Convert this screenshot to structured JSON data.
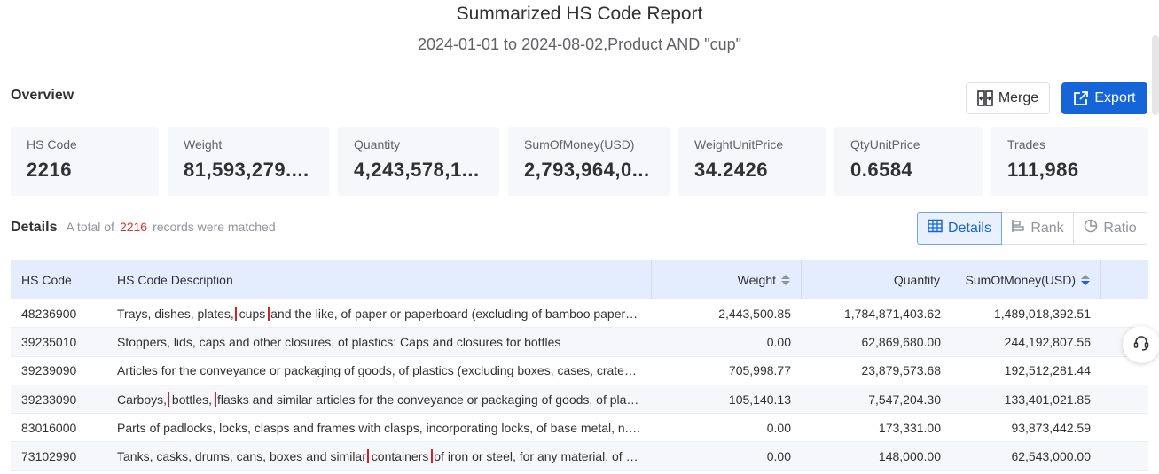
{
  "report": {
    "title": "Summarized HS Code Report",
    "subtitle": "2024-01-01 to 2024-08-02,Product AND \"cup\""
  },
  "overview": {
    "label": "Overview",
    "merge_label": "Merge",
    "export_label": "Export",
    "stats": [
      {
        "label": "HS Code",
        "value": "2216"
      },
      {
        "label": "Weight",
        "value": "81,593,279...."
      },
      {
        "label": "Quantity",
        "value": "4,243,578,1..."
      },
      {
        "label": "SumOfMoney(USD)",
        "value": "2,793,964,0..."
      },
      {
        "label": "WeightUnitPrice",
        "value": "34.2426"
      },
      {
        "label": "QtyUnitPrice",
        "value": "0.6584"
      },
      {
        "label": "Trades",
        "value": "111,986"
      }
    ]
  },
  "details": {
    "label": "Details",
    "note_prefix": "A total of",
    "count": "2216",
    "note_suffix": "records were matched",
    "views": {
      "details": "Details",
      "rank": "Rank",
      "ratio": "Ratio"
    }
  },
  "table": {
    "headers": {
      "hs_code": "HS Code",
      "description": "HS Code Description",
      "weight": "Weight",
      "quantity": "Quantity",
      "sum": "SumOfMoney(USD)"
    },
    "rows": [
      {
        "hs_code": "48236900",
        "desc_before": "Trays, dishes, plates,",
        "highlight": "cups",
        "desc_after": "and the like, of paper or paperboard (excluding of bamboo paper or ba...",
        "weight": "2,443,500.85",
        "quantity": "1,784,871,403.62",
        "sum": "1,489,018,392.51"
      },
      {
        "hs_code": "39235010",
        "desc_before": "Stoppers, lids, caps and other closures, of plastics: Caps and closures for bottles",
        "highlight": "",
        "desc_after": "",
        "weight": "0.00",
        "quantity": "62,869,680.00",
        "sum": "244,192,807.56"
      },
      {
        "hs_code": "39239090",
        "desc_before": "Articles for the conveyance or packaging of goods, of plastics (excluding boxes, cases, crates an...",
        "highlight": "",
        "desc_after": "",
        "weight": "705,998.77",
        "quantity": "23,879,573.68",
        "sum": "192,512,281.44"
      },
      {
        "hs_code": "39233090",
        "desc_before": "Carboys,",
        "highlight": "bottles,",
        "desc_after": "flasks and similar articles for the conveyance or packaging of goods, of plastics...",
        "weight": "105,140.13",
        "quantity": "7,547,204.30",
        "sum": "133,401,021.85"
      },
      {
        "hs_code": "83016000",
        "desc_before": "Parts of padlocks, locks, clasps and frames with clasps, incorporating locks, of base metal, n.e.s.",
        "highlight": "",
        "desc_after": "",
        "weight": "0.00",
        "quantity": "173,331.00",
        "sum": "93,873,442.59"
      },
      {
        "hs_code": "73102990",
        "desc_before": "Tanks, casks, drums, cans, boxes and similar",
        "highlight": "containers",
        "desc_after": "of iron or steel, for any material, of a cap...",
        "weight": "0.00",
        "quantity": "148,000.00",
        "sum": "62,543,000.00"
      }
    ]
  },
  "colors": {
    "accent": "#1565d8",
    "header_bg": "#e4edfd",
    "highlight_box": "#d9201c",
    "count": "#e0302c"
  },
  "icons": {
    "merge": "merge-icon",
    "export": "export-icon",
    "details": "table-icon",
    "rank": "rank-icon",
    "ratio": "pie-icon",
    "support": "headset-icon"
  }
}
